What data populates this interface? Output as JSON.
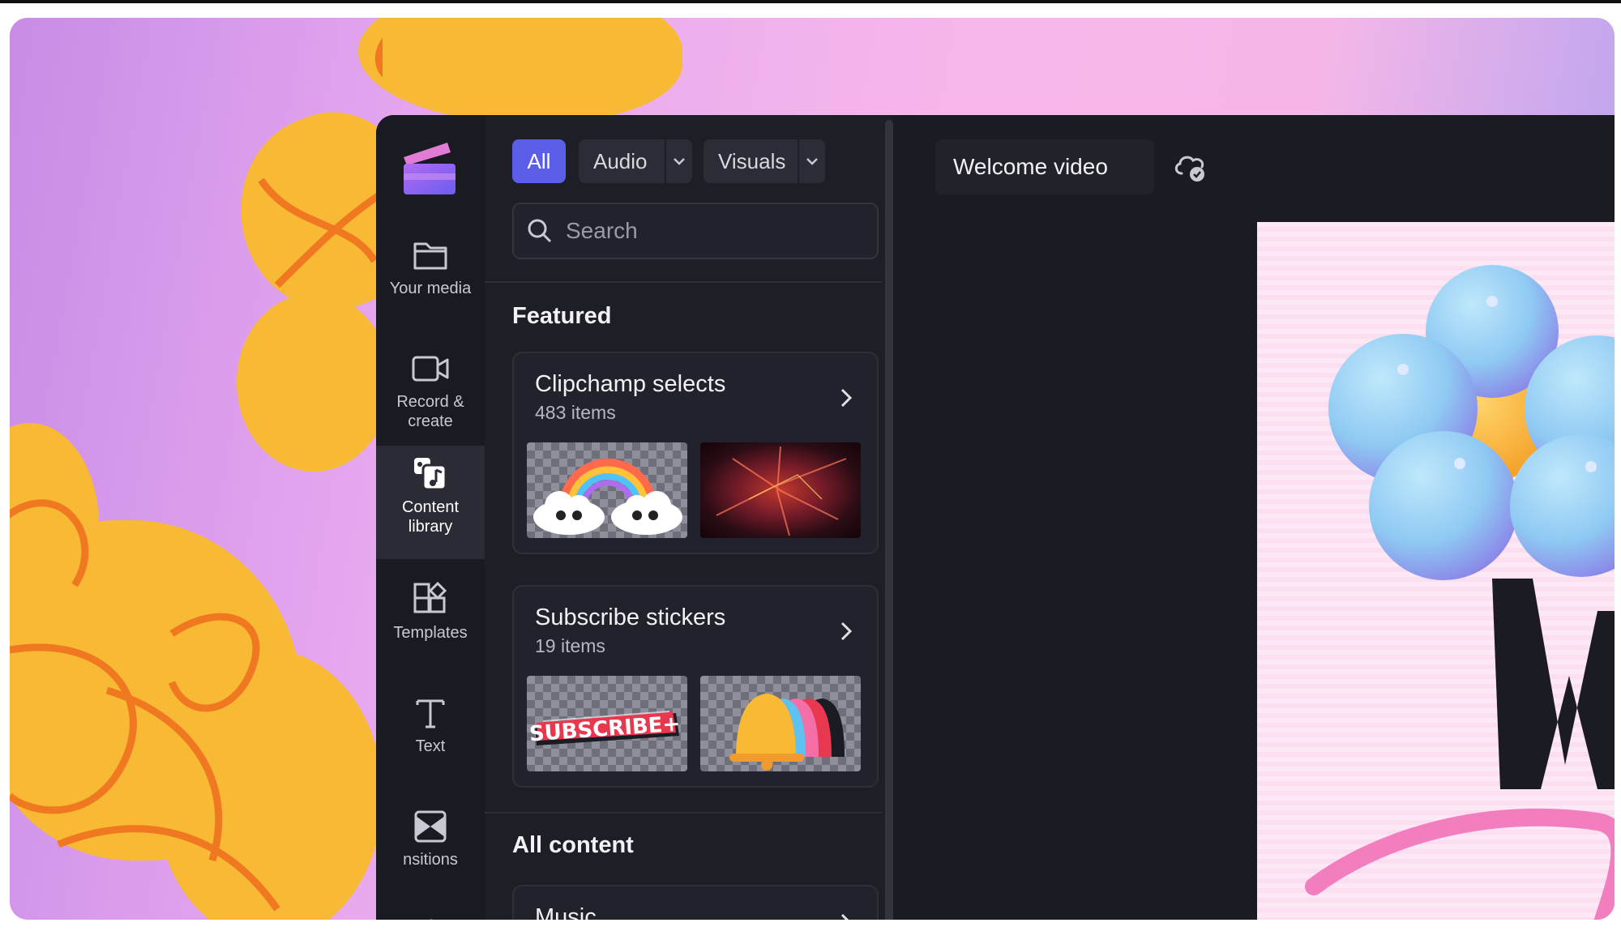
{
  "filters": {
    "all_label": "All",
    "audio_label": "Audio",
    "visuals_label": "Visuals"
  },
  "search": {
    "placeholder": "Search"
  },
  "nav": {
    "items": [
      {
        "label": "Your media",
        "icon": "folder-icon"
      },
      {
        "label": "Record & create",
        "icon": "camera-icon"
      },
      {
        "label": "Content library",
        "icon": "content-library-icon"
      },
      {
        "label": "Templates",
        "icon": "templates-icon"
      },
      {
        "label": "Text",
        "icon": "text-icon"
      },
      {
        "label": "nsitions",
        "icon": "transitions-icon"
      }
    ]
  },
  "featured": {
    "title": "Featured",
    "cards": [
      {
        "title": "Clipchamp selects",
        "count": "483 items"
      },
      {
        "title": "Subscribe stickers",
        "count": "19 items"
      }
    ]
  },
  "all_content": {
    "title": "All content",
    "music_label": "Music"
  },
  "editor": {
    "project_title": "Welcome video"
  },
  "colors": {
    "accent": "#5b5fe8",
    "panel_bg": "#1e1e27",
    "rail_bg": "#1a1a22"
  }
}
